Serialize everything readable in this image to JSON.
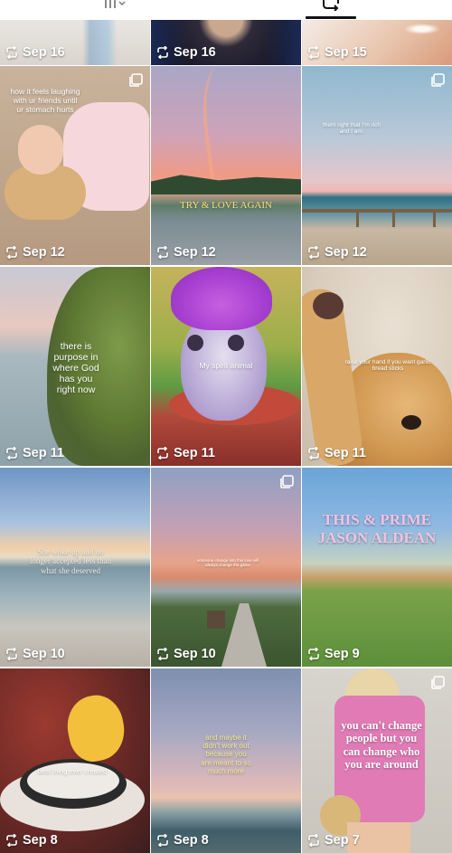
{
  "tabs": [
    {
      "name": "grid-tab",
      "icon": "grid-icon"
    },
    {
      "name": "reposts-tab",
      "icon": "repost-icon",
      "selected": true
    }
  ],
  "icons": {
    "repost": "repost-icon",
    "carousel": "carousel-icon"
  },
  "colors": {
    "text_on_media": "#ffffff",
    "indicator": "#111111"
  },
  "posts": [
    {
      "date": "Sep 16"
    },
    {
      "date": "Sep 16"
    },
    {
      "date": "Sep 15"
    },
    {
      "date": "Sep 12",
      "overlay": "how it feels laughing with ur friends until ur stomach hurts",
      "carousel": true
    },
    {
      "date": "Sep 12",
      "overlay": "TRY & LOVE AGAIN"
    },
    {
      "date": "Sep 12",
      "overlay": "them right that I'm rich and I am.",
      "carousel": true
    },
    {
      "date": "Sep 11",
      "overlay": "there is purpose in where God has you right now"
    },
    {
      "date": "Sep 11",
      "overlay": "My spirit animal"
    },
    {
      "date": "Sep 11",
      "overlay": "raise your hand if you want garlic bread sticks"
    },
    {
      "date": "Sep 10",
      "overlay": "She woke up and no longer accepted less than what she deserved"
    },
    {
      "date": "Sep 10",
      "overlay": "someone change into this love will always change the game",
      "carousel": true
    },
    {
      "date": "Sep 9",
      "overlay": "THIS & PRIME JASON ALDEAN"
    },
    {
      "date": "Sep 8",
      "overlay": "best thing ever created"
    },
    {
      "date": "Sep 8",
      "overlay": "and maybe it didn't work out because you are meant to so much more"
    },
    {
      "date": "Sep 7",
      "overlay": "you can't change people but you can change who you are around",
      "carousel": true
    }
  ]
}
